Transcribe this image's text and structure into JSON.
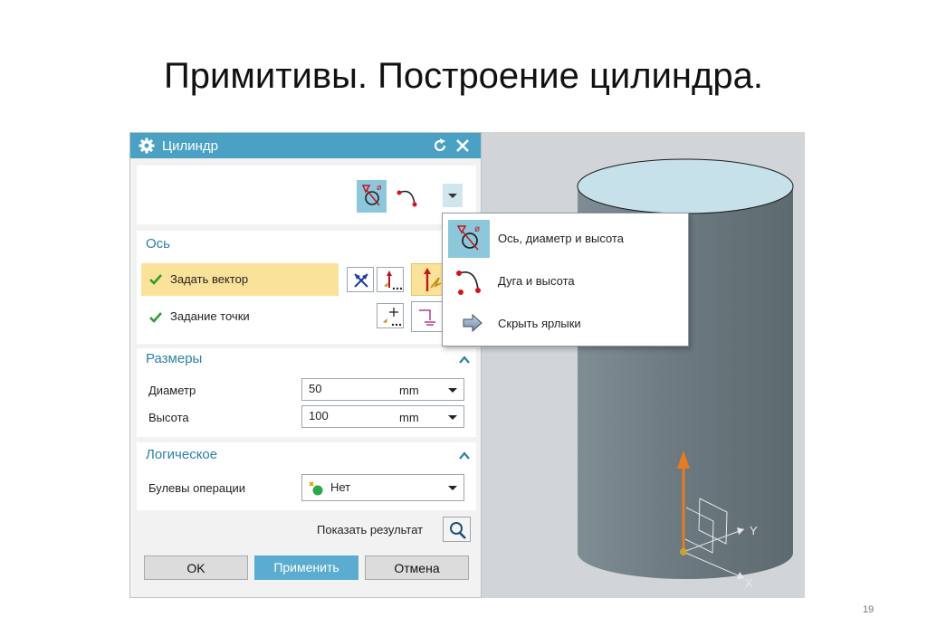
{
  "slide": {
    "title": "Примитивы. Построение цилиндра.",
    "page_number": "19"
  },
  "dialog": {
    "title": "Цилиндр",
    "sections": {
      "axis": {
        "heading": "Ось",
        "specify_vector": "Задать вектор",
        "specify_point": "Задание точки"
      },
      "dimensions": {
        "heading": "Размеры",
        "diameter_label": "Диаметр",
        "diameter_value": "50",
        "diameter_unit": "mm",
        "height_label": "Высота",
        "height_value": "100",
        "height_unit": "mm"
      },
      "boolean": {
        "heading": "Логическое",
        "operations_label": "Булевы операции",
        "operations_value": "Нет"
      }
    },
    "show_result_label": "Показать результат",
    "buttons": {
      "ok": "OK",
      "apply": "Применить",
      "cancel": "Отмена"
    }
  },
  "type_menu": {
    "items": [
      {
        "label": "Ось, диаметр и высота",
        "icon": "axis-diameter-height-icon",
        "selected": true
      },
      {
        "label": "Дуга и высота",
        "icon": "arc-height-icon",
        "selected": false
      },
      {
        "label": "Скрыть ярлыки",
        "icon": "arrow-right-icon",
        "selected": false
      }
    ]
  },
  "viewport": {
    "axis_labels": {
      "y": "Y",
      "x": "X"
    }
  },
  "colors": {
    "titlebar": "#4aa1c4",
    "section_heading": "#2c7fa8",
    "highlight": "#fbe29a",
    "apply_button": "#5aacd0",
    "cylinder_body": "#6f7d84",
    "cylinder_top": "#c7e1ea",
    "z_axis": "#e87a20"
  }
}
